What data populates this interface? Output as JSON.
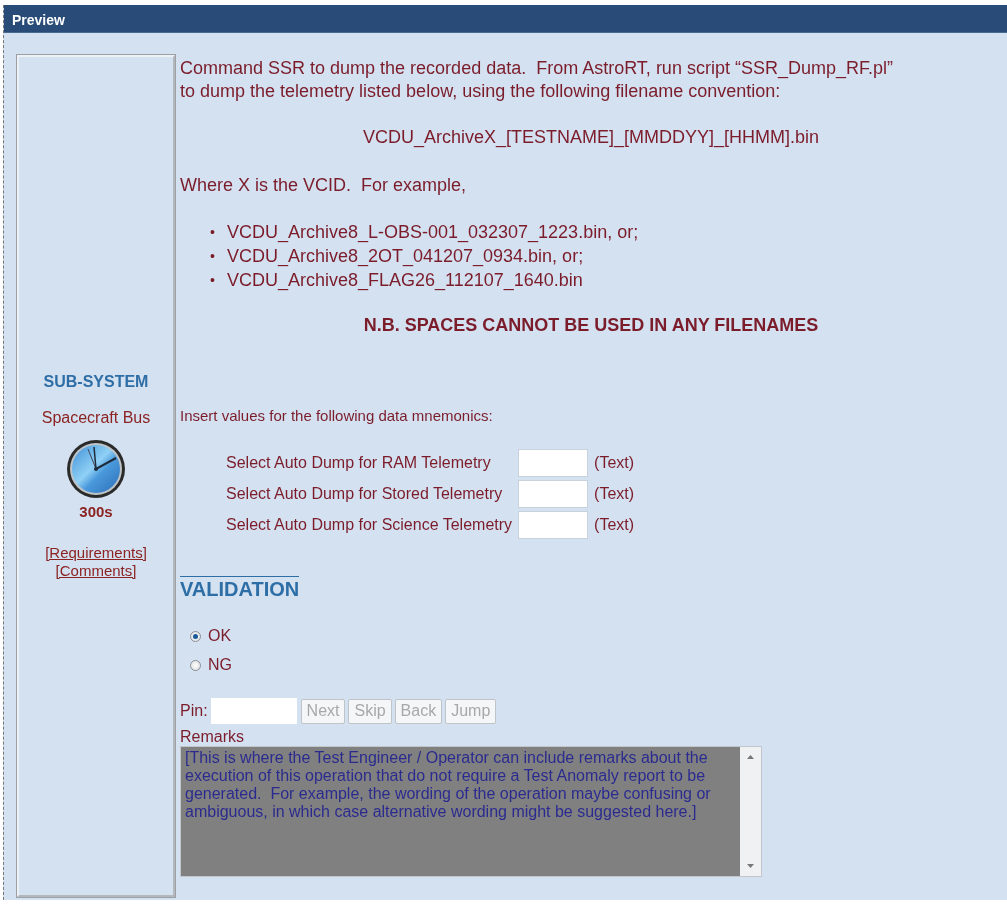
{
  "window": {
    "title": "Preview"
  },
  "sidebar": {
    "heading": "SUB-SYSTEM",
    "subsystem": "Spacecraft Bus",
    "timer": "300s",
    "links": [
      "[Requirements]",
      "[Comments]"
    ]
  },
  "instruction": {
    "paragraph": "Command SSR to dump the recorded data.  From AstroRT, run script “SSR_Dump_RF.pl” to dump the telemetry listed below, using the following filename convention:",
    "filename_pattern": "VCDU_ArchiveX_[TESTNAME]_[MMDDYY]_[HHMM].bin",
    "example_intro": "Where X is the VCID.  For example,",
    "bullet": "•",
    "examples": [
      "VCDU_Archive8_L-OBS-001_032307_1223.bin, or;",
      "VCDU_Archive8_2OT_041207_0934.bin, or;",
      "VCDU_Archive8_FLAG26_112107_1640.bin"
    ],
    "note": "N.B. SPACES CANNOT BE USED IN ANY FILENAMES"
  },
  "mnemonics": {
    "prompt": "Insert values for the following data mnemonics:",
    "fields": [
      {
        "label": "Select Auto Dump for RAM Telemetry",
        "type_hint": "(Text)"
      },
      {
        "label": "Select Auto Dump for Stored Telemetry",
        "type_hint": "(Text)"
      },
      {
        "label": "Select Auto Dump for Science Telemetry",
        "type_hint": "(Text)"
      }
    ]
  },
  "validation": {
    "heading": "VALIDATION",
    "options": [
      {
        "label": "OK",
        "selected": true
      },
      {
        "label": "NG",
        "selected": false
      }
    ]
  },
  "navigation": {
    "pin_label": "Pin:",
    "buttons": [
      {
        "label": "Next",
        "disabled": true
      },
      {
        "label": "Skip",
        "disabled": true
      },
      {
        "label": "Back",
        "disabled": true
      },
      {
        "label": "Jump",
        "disabled": true
      }
    ]
  },
  "remarks": {
    "label": "Remarks",
    "value": "[This is where the Test Engineer / Operator can include remarks about the execution of this operation that do not require a Test Anomaly report to be generated.  For example, the wording of the operation maybe confusing or ambiguous, in which case alternative wording might be suggested here.]"
  }
}
